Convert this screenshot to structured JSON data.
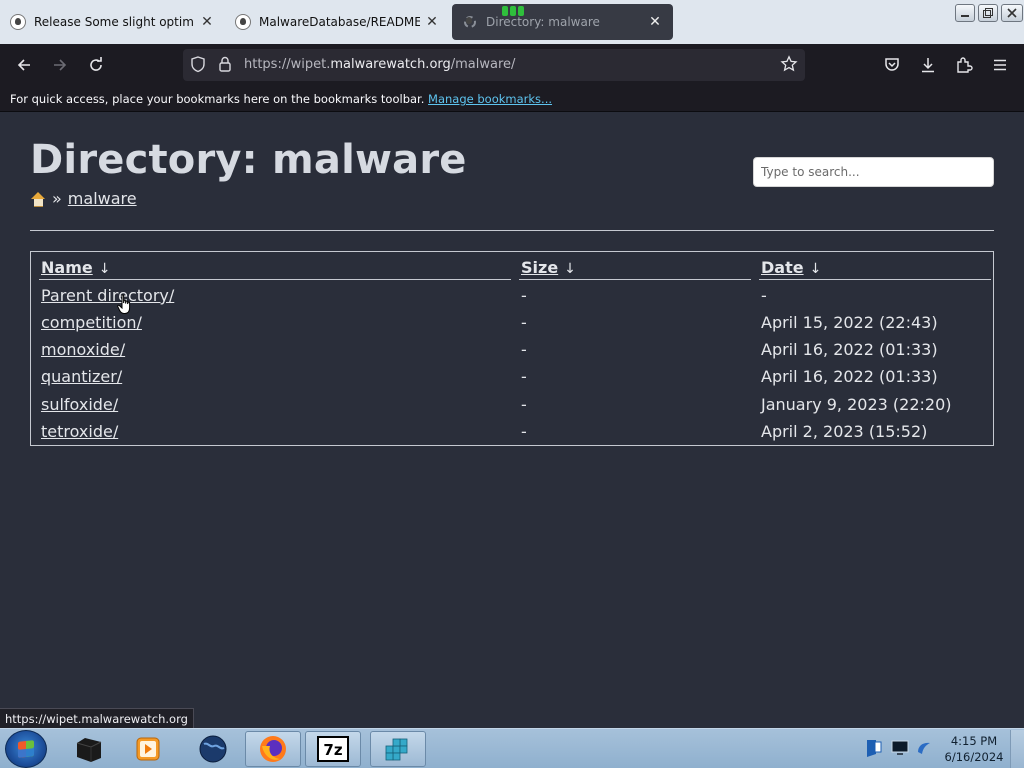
{
  "browser": {
    "tabs": [
      {
        "title": "Release Some slight optimizati",
        "icon": "github-icon",
        "active": false
      },
      {
        "title": "MalwareDatabase/README.md",
        "icon": "github-icon",
        "active": false
      },
      {
        "title": "Directory: malware",
        "icon": "loading-icon",
        "active": true
      }
    ],
    "url_prefix": "https://wipet.",
    "url_domain": "malwarewatch.org",
    "url_path": "/malware/",
    "bookmarks_message": "For quick access, place your bookmarks here on the bookmarks toolbar.",
    "bookmarks_link": "Manage bookmarks..."
  },
  "page": {
    "title": "Directory: malware",
    "breadcrumb_separator": "»",
    "breadcrumb_current": "malware",
    "search_placeholder": "Type to search...",
    "columns": {
      "name": "Name",
      "size": "Size",
      "date": "Date",
      "sort_arrow": "↓"
    },
    "entries": [
      {
        "name": "Parent directory/",
        "size": "-",
        "date": "-"
      },
      {
        "name": "competition/",
        "size": "-",
        "date": "April 15, 2022 (22:43)"
      },
      {
        "name": "monoxide/",
        "size": "-",
        "date": "April 16, 2022 (01:33)"
      },
      {
        "name": "quantizer/",
        "size": "-",
        "date": "April 16, 2022 (01:33)"
      },
      {
        "name": "sulfoxide/",
        "size": "-",
        "date": "January 9, 2023 (22:20)"
      },
      {
        "name": "tetroxide/",
        "size": "-",
        "date": "April 2, 2023 (15:52)"
      }
    ]
  },
  "status_bar": {
    "link_preview": "https://wipet.malwarewatch.org"
  },
  "taskbar": {
    "apps": [
      "terminal-icon",
      "media-player-icon",
      "globe-icon",
      "firefox-icon",
      "7zip-icon",
      "registry-editor-icon"
    ],
    "clock_time": "4:15 PM",
    "clock_date": "6/16/2024"
  },
  "colors": {
    "page_bg": "#2a2e3a",
    "link": "#5ec4ef",
    "text": "#e4e6ea"
  }
}
